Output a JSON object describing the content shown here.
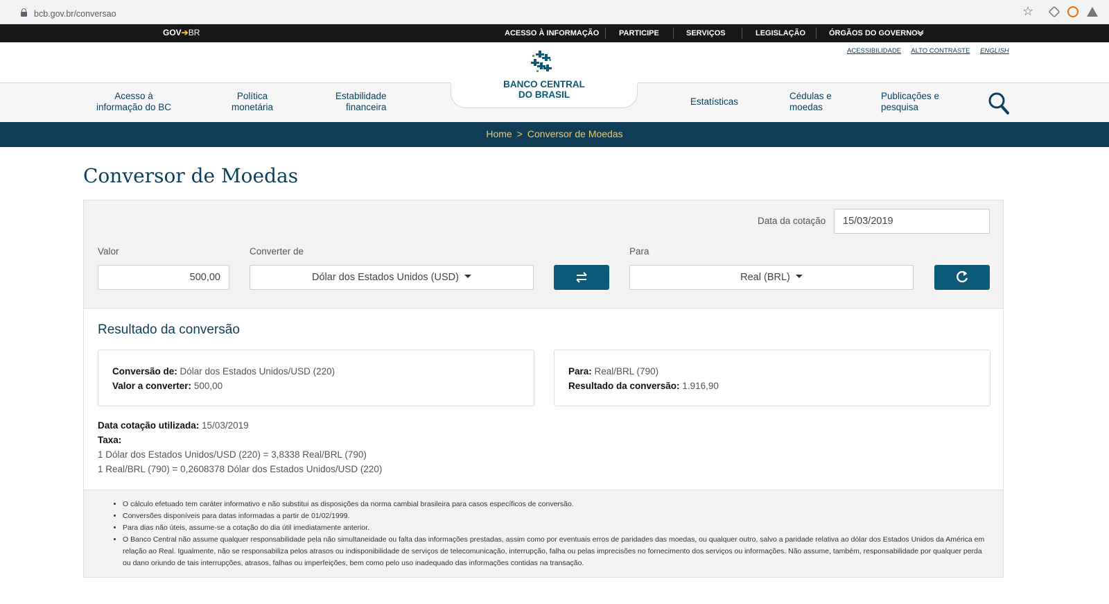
{
  "browser": {
    "url": "bcb.gov.br/conversao"
  },
  "gov_bar": {
    "logo_gov": "GOV",
    "logo_br": "BR",
    "links": [
      "ACESSO À INFORMAÇÃO",
      "PARTICIPE",
      "SERVIÇOS",
      "LEGISLAÇÃO",
      "ÓRGÃOS DO GOVERNO"
    ]
  },
  "accessibility": {
    "acessibilidade": "ACESSIBILIDADE",
    "alto_contraste": "ALTO CONTRASTE",
    "english": "ENGLISH"
  },
  "logo": {
    "line1": "BANCO CENTRAL",
    "line2": "DO BRASIL"
  },
  "nav": {
    "acesso_1": "Acesso à",
    "acesso_2": "informação do BC",
    "politica_1": "Política",
    "politica_2": "monetária",
    "estabilidade_1": "Estabilidade",
    "estabilidade_2": "financeira",
    "estatisticas": "Estatísticas",
    "cedulas_1": "Cédulas e",
    "cedulas_2": "moedas",
    "publicacoes_1": "Publicações e",
    "publicacoes_2": "pesquisa"
  },
  "breadcrumb": {
    "home": "Home",
    "separator": ">",
    "current": "Conversor de Moedas"
  },
  "page": {
    "title": "Conversor de Moedas"
  },
  "form": {
    "date_label": "Data da cotação",
    "date_value": "15/03/2019",
    "valor_label": "Valor",
    "valor_value": "500,00",
    "from_label": "Converter de",
    "from_value": "Dólar dos Estados Unidos (USD)",
    "to_label": "Para",
    "to_value": "Real (BRL)"
  },
  "result": {
    "title": "Resultado da conversão",
    "conversao_de_label": "Conversão de:",
    "conversao_de_value": " Dólar dos Estados Unidos/USD (220)",
    "valor_label": "Valor a converter:",
    "valor_value": " 500,00",
    "para_label": "Para:",
    "para_value": " Real/BRL (790)",
    "resultado_label": "Resultado da conversão:",
    "resultado_value": " 1.916,90",
    "data_label": "Data cotação utilizada:",
    "data_value": " 15/03/2019",
    "taxa_label": "Taxa:",
    "taxa_line1": "1 Dólar dos Estados Unidos/USD (220) = 3,8338 Real/BRL (790)",
    "taxa_line2": "1 Real/BRL (790) = 0,2608378 Dólar dos Estados Unidos/USD (220)"
  },
  "notes": [
    "O cálculo efetuado tem caráter informativo e não substitui as disposições da norma cambial brasileira para casos específicos de conversão.",
    "Conversões disponíveis para datas informadas a partir de 01/02/1999.",
    "Para dias não úteis, assume-se a cotação do dia útil imediatamente anterior.",
    "O Banco Central não assume qualquer responsabilidade pela não simultaneidade ou falta das informações prestadas, assim como por eventuais erros de paridades das moedas, ou qualquer outro, salvo a paridade relativa ao dólar dos Estados Unidos da América em relação ao Real. Igualmente, não se responsabiliza pelos atrasos ou indisponibilidade de serviços de telecomunicação, interrupção, falha ou pelas imprecisões no fornecimento dos serviços ou informações. Não assume, também, responsabilidade por qualquer perda ou dano oriundo de tais interrupções, atrasos, falhas ou imperfeições, bem como pelo uso inadequado das informações contidas na transação."
  ],
  "colors": {
    "brand_dark": "#0f3d57",
    "brand": "#0c5a78",
    "breadcrumb_text": "#f0c96d"
  },
  "icons": [
    "lock-icon",
    "star-icon",
    "search-icon",
    "swap-icon",
    "refresh-icon",
    "caret-down-icon",
    "chevron-down-icon"
  ]
}
